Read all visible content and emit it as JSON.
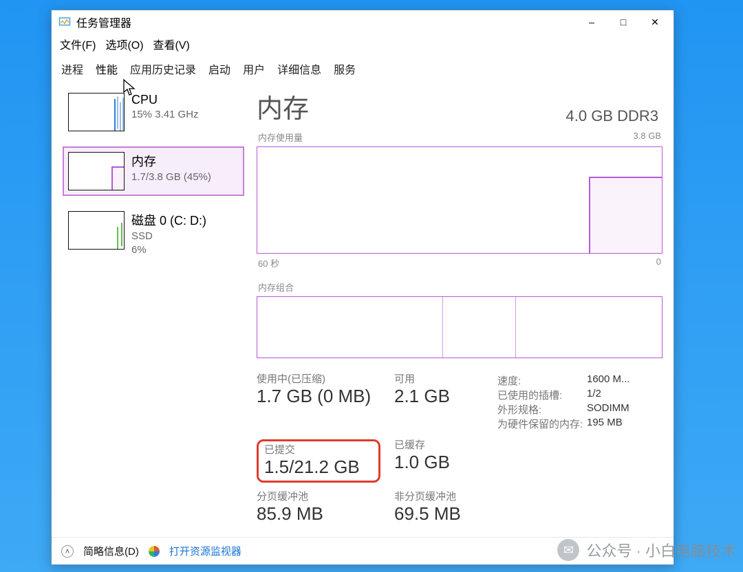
{
  "window": {
    "title": "任务管理器",
    "minimize": "–",
    "maximize": "□",
    "close": "✕"
  },
  "menubar": {
    "file": "文件(F)",
    "options": "选项(O)",
    "view": "查看(V)"
  },
  "tabs": {
    "processes": "进程",
    "performance": "性能",
    "appHistory": "应用历史记录",
    "startup": "启动",
    "users": "用户",
    "details": "详细信息",
    "services": "服务"
  },
  "sidebar": {
    "cpu": {
      "title": "CPU",
      "line1": "15% 3.41 GHz"
    },
    "memory": {
      "title": "内存",
      "line1": "1.7/3.8 GB (45%)"
    },
    "disk": {
      "title": "磁盘 0 (C: D:)",
      "line1": "SSD",
      "line2": "6%"
    }
  },
  "main": {
    "heading": "内存",
    "subheading": "4.0 GB DDR3",
    "usage_label": "内存使用量",
    "usage_max": "3.8 GB",
    "axis_left": "60 秒",
    "axis_right": "0",
    "comp_label": "内存组合",
    "stats": {
      "in_use_lbl": "使用中(已压缩)",
      "in_use_val": "1.7 GB (0 MB)",
      "available_lbl": "可用",
      "available_val": "2.1 GB",
      "committed_lbl": "已提交",
      "committed_val": "1.5/21.2 GB",
      "cached_lbl": "已缓存",
      "cached_val": "1.0 GB",
      "paged_lbl": "分页缓冲池",
      "paged_val": "85.9 MB",
      "nonpaged_lbl": "非分页缓冲池",
      "nonpaged_val": "69.5 MB"
    },
    "kv": {
      "speed_k": "速度:",
      "speed_v": "1600 M...",
      "slots_k": "已使用的插槽:",
      "slots_v": "1/2",
      "form_k": "外形规格:",
      "form_v": "SODIMM",
      "hw_k": "为硬件保留的内存:",
      "hw_v": "195 MB"
    }
  },
  "statusbar": {
    "brief": "简略信息(D)",
    "resmon": "打开资源监视器"
  },
  "watermark": "公众号 · 小白电脑技术"
}
